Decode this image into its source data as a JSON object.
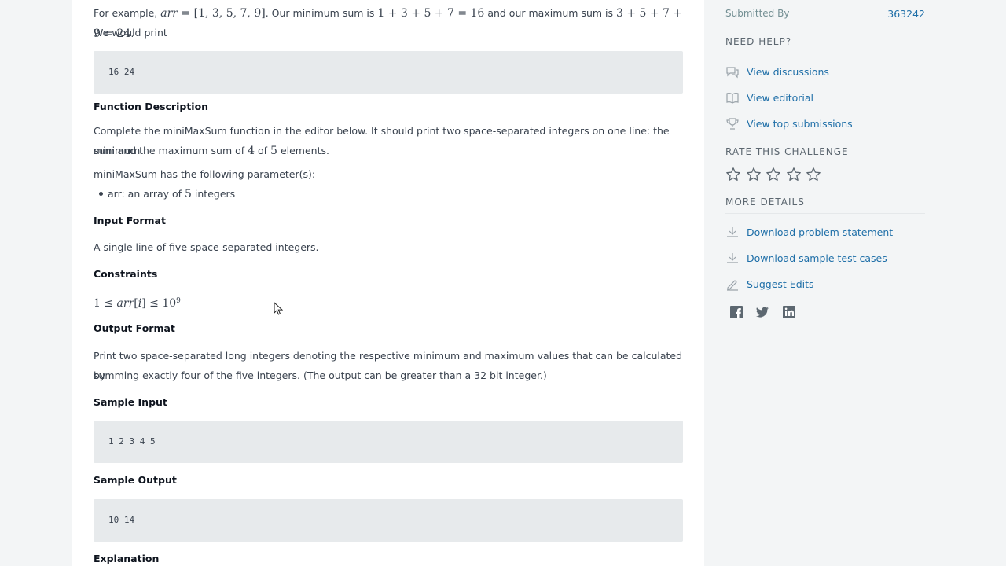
{
  "problem": {
    "example_pre": "For example, ",
    "example_arr_math": "arr",
    "example_arr_val": " = [1, 3, 5, 7, 9]",
    "example_mid": ". Our minimum sum is ",
    "example_min_math": "1 + 3 + 5 + 7 = 16",
    "example_mid2": " and our maximum sum is ",
    "example_max_math": "3 + 5 + 7 + 9 = 24",
    "example_end": ".",
    "example_line2": "We would print",
    "example_output": "16 24",
    "func_heading": "Function Description",
    "func_text_1": "Complete the miniMaxSum function in the editor below. It should print two space-separated integers on one line: the minimum",
    "func_text_2a": "sum and the maximum sum of ",
    "func_text_2b": "4",
    "func_text_2c": " of ",
    "func_text_2d": "5",
    "func_text_2e": " elements.",
    "params_text": "miniMaxSum has the following parameter(s):",
    "param_1a": "arr: an array of ",
    "param_1b": "5",
    "param_1c": " integers",
    "input_heading": "Input Format",
    "input_text": "A single line of five space-separated integers.",
    "constraints_heading": "Constraints",
    "constraint_a": "1 ≤ ",
    "constraint_b": "arr",
    "constraint_c": "[",
    "constraint_d": "i",
    "constraint_e": "] ≤ 10",
    "constraint_exp": "9",
    "output_heading": "Output Format",
    "output_text_1": "Print two space-separated long integers denoting the respective minimum and maximum values that can be calculated by",
    "output_text_2": "summing exactly four of the five integers. (The output can be greater than a 32 bit integer.)",
    "sample_input_heading": "Sample Input",
    "sample_input": "1 2 3 4 5",
    "sample_output_heading": "Sample Output",
    "sample_output": "10 14",
    "explanation_heading": "Explanation"
  },
  "sidebar": {
    "submitted_by_label": "Submitted By",
    "submitted_by_value": "363242",
    "need_help": "NEED HELP?",
    "links_help": [
      "View discussions",
      "View editorial",
      "View top submissions"
    ],
    "rate_heading": "RATE THIS CHALLENGE",
    "rating": 0,
    "rating_max": 5,
    "more_details": "MORE DETAILS",
    "links_details": [
      "Download problem statement",
      "Download sample test cases",
      "Suggest Edits"
    ]
  },
  "colors": {
    "link": "#1f6fa8",
    "page_bg": "#f3f5f6",
    "code_bg": "#e7eaec"
  }
}
